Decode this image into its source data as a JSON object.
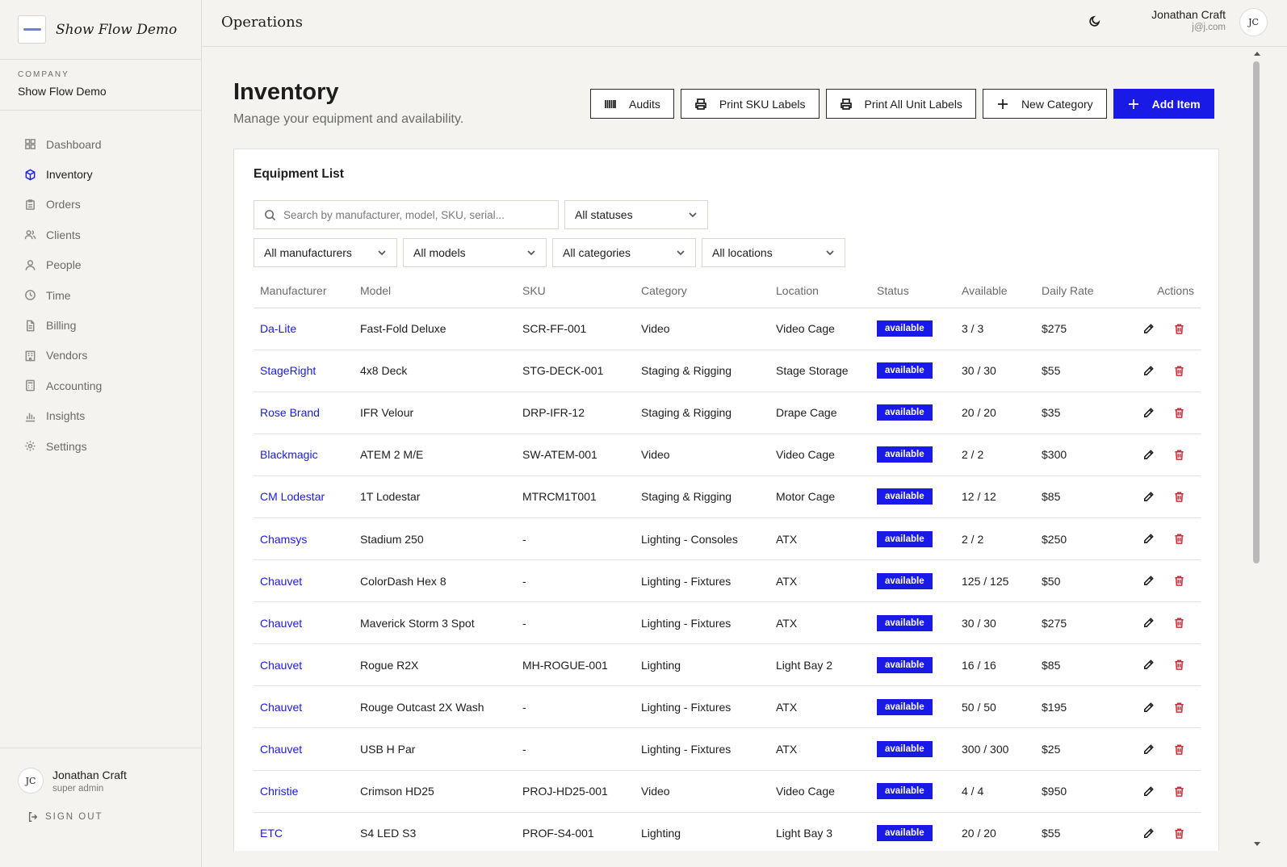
{
  "brand": {
    "name": "Show Flow Demo"
  },
  "company": {
    "label": "COMPANY",
    "name": "Show Flow Demo"
  },
  "nav": [
    {
      "label": "Dashboard",
      "icon": "grid-icon",
      "active": false
    },
    {
      "label": "Inventory",
      "icon": "box-icon",
      "active": true
    },
    {
      "label": "Orders",
      "icon": "clipboard-icon",
      "active": false
    },
    {
      "label": "Clients",
      "icon": "users-icon",
      "active": false
    },
    {
      "label": "People",
      "icon": "user-icon",
      "active": false
    },
    {
      "label": "Time",
      "icon": "clock-icon",
      "active": false
    },
    {
      "label": "Billing",
      "icon": "file-icon",
      "active": false
    },
    {
      "label": "Vendors",
      "icon": "building-icon",
      "active": false
    },
    {
      "label": "Accounting",
      "icon": "calculator-icon",
      "active": false
    },
    {
      "label": "Insights",
      "icon": "bar-chart-icon",
      "active": false
    },
    {
      "label": "Settings",
      "icon": "gear-icon",
      "active": false
    }
  ],
  "sidebar_user": {
    "initials": "JC",
    "name": "Jonathan Craft",
    "role": "super admin",
    "sign_out": "SIGN OUT"
  },
  "topbar": {
    "title": "Operations",
    "user_name": "Jonathan Craft",
    "user_email": "j@j.com",
    "initials": "JC"
  },
  "page": {
    "title": "Inventory",
    "subtitle": "Manage your equipment and availability."
  },
  "actions": {
    "audits": "Audits",
    "print_sku": "Print SKU Labels",
    "print_units": "Print All Unit Labels",
    "new_category": "New Category",
    "add_item": "Add Item"
  },
  "card": {
    "title": "Equipment List"
  },
  "filters": {
    "search_placeholder": "Search by manufacturer, model, SKU, serial...",
    "status": "All statuses",
    "manufacturer": "All manufacturers",
    "model": "All models",
    "category": "All categories",
    "location": "All locations"
  },
  "table": {
    "headers": [
      "Manufacturer",
      "Model",
      "SKU",
      "Category",
      "Location",
      "Status",
      "Available",
      "Daily Rate",
      "Actions"
    ],
    "rows": [
      {
        "manufacturer": "Da-Lite",
        "model": "Fast-Fold Deluxe",
        "sku": "SCR-FF-001",
        "category": "Video",
        "location": "Video Cage",
        "status": "available",
        "available": "3 / 3",
        "rate": "$275"
      },
      {
        "manufacturer": "StageRight",
        "model": "4x8 Deck",
        "sku": "STG-DECK-001",
        "category": "Staging & Rigging",
        "location": "Stage Storage",
        "status": "available",
        "available": "30 / 30",
        "rate": "$55"
      },
      {
        "manufacturer": "Rose Brand",
        "model": "IFR Velour",
        "sku": "DRP-IFR-12",
        "category": "Staging & Rigging",
        "location": "Drape Cage",
        "status": "available",
        "available": "20 / 20",
        "rate": "$35"
      },
      {
        "manufacturer": "Blackmagic",
        "model": "ATEM 2 M/E",
        "sku": "SW-ATEM-001",
        "category": "Video",
        "location": "Video Cage",
        "status": "available",
        "available": "2 / 2",
        "rate": "$300"
      },
      {
        "manufacturer": "CM Lodestar",
        "model": "1T Lodestar",
        "sku": "MTRCM1T001",
        "category": "Staging & Rigging",
        "location": "Motor Cage",
        "status": "available",
        "available": "12 / 12",
        "rate": "$85"
      },
      {
        "manufacturer": "Chamsys",
        "model": "Stadium 250",
        "sku": "-",
        "category": "Lighting - Consoles",
        "location": "ATX",
        "status": "available",
        "available": "2 / 2",
        "rate": "$250"
      },
      {
        "manufacturer": "Chauvet",
        "model": "ColorDash Hex 8",
        "sku": "-",
        "category": "Lighting - Fixtures",
        "location": "ATX",
        "status": "available",
        "available": "125 / 125",
        "rate": "$50"
      },
      {
        "manufacturer": "Chauvet",
        "model": "Maverick Storm 3 Spot",
        "sku": "-",
        "category": "Lighting - Fixtures",
        "location": "ATX",
        "status": "available",
        "available": "30 / 30",
        "rate": "$275"
      },
      {
        "manufacturer": "Chauvet",
        "model": "Rogue R2X",
        "sku": "MH-ROGUE-001",
        "category": "Lighting",
        "location": "Light Bay 2",
        "status": "available",
        "available": "16 / 16",
        "rate": "$85"
      },
      {
        "manufacturer": "Chauvet",
        "model": "Rouge Outcast 2X Wash",
        "sku": "-",
        "category": "Lighting - Fixtures",
        "location": "ATX",
        "status": "available",
        "available": "50 / 50",
        "rate": "$195"
      },
      {
        "manufacturer": "Chauvet",
        "model": "USB H Par",
        "sku": "-",
        "category": "Lighting - Fixtures",
        "location": "ATX",
        "status": "available",
        "available": "300 / 300",
        "rate": "$25"
      },
      {
        "manufacturer": "Christie",
        "model": "Crimson HD25",
        "sku": "PROJ-HD25-001",
        "category": "Video",
        "location": "Video Cage",
        "status": "available",
        "available": "4 / 4",
        "rate": "$950"
      },
      {
        "manufacturer": "ETC",
        "model": "S4 LED S3",
        "sku": "PROF-S4-001",
        "category": "Lighting",
        "location": "Light Bay 3",
        "status": "available",
        "available": "20 / 20",
        "rate": "$55"
      }
    ]
  },
  "colors": {
    "accent": "#1a1ae6",
    "danger": "#cc2e3a",
    "background": "#f4f3ef"
  }
}
